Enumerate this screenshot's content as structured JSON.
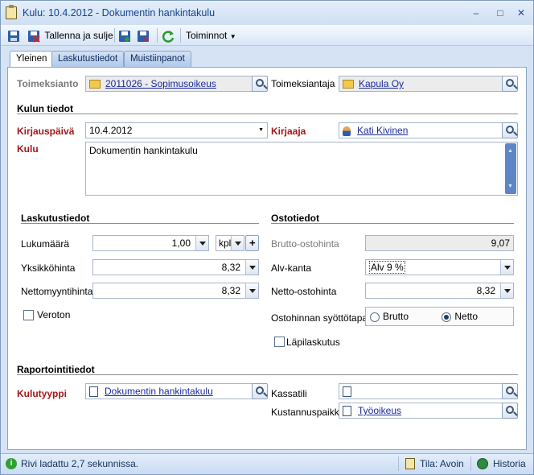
{
  "window": {
    "title": "Kulu: 10.4.2012 - Dokumentin hankintakulu"
  },
  "toolbar": {
    "save_close": "Tallenna ja sulje",
    "actions": "Toiminnot"
  },
  "tabs": [
    "Yleinen",
    "Laskutustiedot",
    "Muistiinpanot"
  ],
  "header_fields": {
    "assignment_label": "Toimeksianto",
    "assignment_value": "2011026 - Sopimusoikeus",
    "client_label": "Toimeksiantaja",
    "client_value": "Kapula Oy"
  },
  "expense_section": {
    "title": "Kulun tiedot",
    "date_label": "Kirjauspäivä",
    "date_value": "10.4.2012",
    "recorder_label": "Kirjaaja",
    "recorder_value": "Kati Kivinen",
    "expense_label": "Kulu",
    "expense_value": "Dokumentin hankintakulu"
  },
  "billing": {
    "title": "Laskutustiedot",
    "qty_label": "Lukumäärä",
    "qty_value": "1,00",
    "unit_value": "kpl",
    "unit_price_label": "Yksikköhinta",
    "unit_price_value": "8,32",
    "net_sale_label": "Nettomyyntihinta",
    "net_sale_value": "8,32",
    "tax_free_label": "Veroton"
  },
  "purchase": {
    "title": "Ostotiedot",
    "gross_label": "Brutto-ostohinta",
    "gross_value": "9,07",
    "vat_label": "Alv-kanta",
    "vat_value": "Alv 9 %",
    "net_label": "Netto-ostohinta",
    "net_value": "8,32",
    "entry_mode_label": "Ostohinnan syöttötapa",
    "entry_mode_options": [
      "Brutto",
      "Netto"
    ],
    "entry_mode_selected": "Netto",
    "pass_through_label": "Läpilaskutus"
  },
  "reporting": {
    "title": "Raportointitiedot",
    "type_label": "Kulutyyppi",
    "type_value": "Dokumentin hankintakulu",
    "cash_label": "Kassatili",
    "cash_value": "",
    "cost_center_label": "Kustannuspaikka",
    "cost_center_value": "Työoikeus"
  },
  "status": {
    "message": "Rivi ladattu 2,7 sekunnissa.",
    "state": "Tila: Avoin",
    "history": "Historia"
  },
  "colors": {
    "required_label": "#a3171b",
    "link": "#1a2a9c",
    "chrome": "#d5e3f5"
  }
}
